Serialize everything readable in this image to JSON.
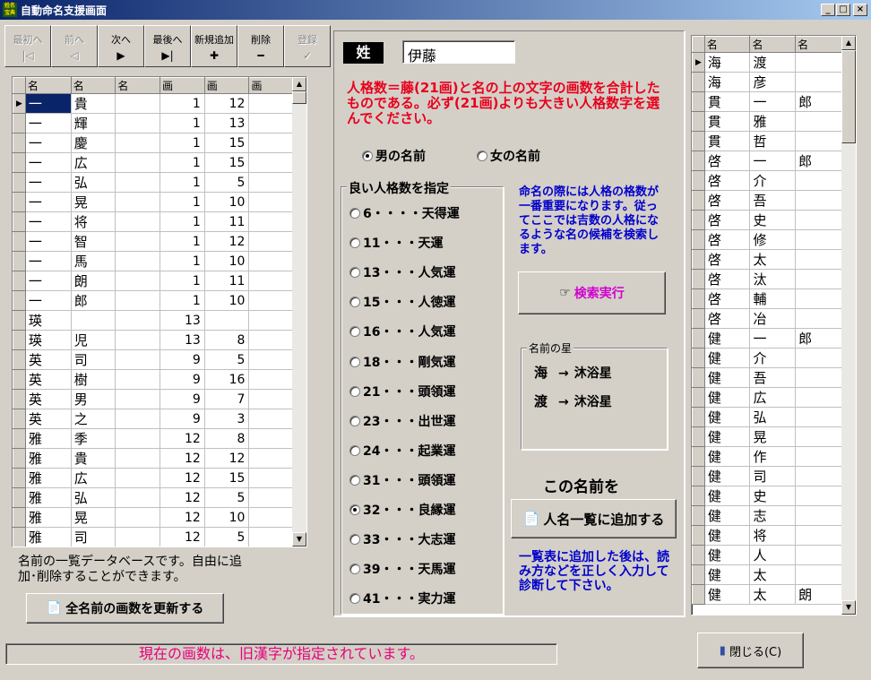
{
  "window": {
    "title": "自動命名支援画面",
    "icon_text": "姓名宝典",
    "buttons": [
      "_",
      "□",
      "×"
    ]
  },
  "navigator": [
    {
      "label": "最初へ",
      "glyph": "|◁",
      "enabled": false
    },
    {
      "label": "前へ",
      "glyph": "◁",
      "enabled": false
    },
    {
      "label": "次へ",
      "glyph": "▶",
      "enabled": true
    },
    {
      "label": "最後へ",
      "glyph": "▶|",
      "enabled": true
    },
    {
      "label": "新規追加",
      "glyph": "✚",
      "enabled": true
    },
    {
      "label": "削除",
      "glyph": "━",
      "enabled": true
    },
    {
      "label": "登録",
      "glyph": "✓",
      "enabled": false
    }
  ],
  "name_db": {
    "columns": [
      "名",
      "名",
      "名",
      "画",
      "画",
      "画"
    ],
    "rows": [
      [
        "一",
        "貴",
        "",
        "1",
        "12",
        ""
      ],
      [
        "一",
        "輝",
        "",
        "1",
        "13",
        ""
      ],
      [
        "一",
        "慶",
        "",
        "1",
        "15",
        ""
      ],
      [
        "一",
        "広",
        "",
        "1",
        "15",
        ""
      ],
      [
        "一",
        "弘",
        "",
        "1",
        "5",
        ""
      ],
      [
        "一",
        "晃",
        "",
        "1",
        "10",
        ""
      ],
      [
        "一",
        "将",
        "",
        "1",
        "11",
        ""
      ],
      [
        "一",
        "智",
        "",
        "1",
        "12",
        ""
      ],
      [
        "一",
        "馬",
        "",
        "1",
        "10",
        ""
      ],
      [
        "一",
        "朗",
        "",
        "1",
        "11",
        ""
      ],
      [
        "一",
        "郎",
        "",
        "1",
        "10",
        ""
      ],
      [
        "瑛",
        "",
        "",
        "13",
        "",
        ""
      ],
      [
        "瑛",
        "児",
        "",
        "13",
        "8",
        ""
      ],
      [
        "英",
        "司",
        "",
        "9",
        "5",
        ""
      ],
      [
        "英",
        "樹",
        "",
        "9",
        "16",
        ""
      ],
      [
        "英",
        "男",
        "",
        "9",
        "7",
        ""
      ],
      [
        "英",
        "之",
        "",
        "9",
        "3",
        ""
      ],
      [
        "雅",
        "季",
        "",
        "12",
        "8",
        ""
      ],
      [
        "雅",
        "貴",
        "",
        "12",
        "12",
        ""
      ],
      [
        "雅",
        "広",
        "",
        "12",
        "15",
        ""
      ],
      [
        "雅",
        "弘",
        "",
        "12",
        "5",
        ""
      ],
      [
        "雅",
        "晃",
        "",
        "12",
        "10",
        ""
      ],
      [
        "雅",
        "司",
        "",
        "12",
        "5",
        ""
      ]
    ],
    "description": "名前の一覧データベースです。自由に追加･削除することができます。",
    "update_button": "全名前の画数を更新する"
  },
  "surname": {
    "label": "姓",
    "value": "伊藤"
  },
  "instruction": "人格数＝藤(21画)と名の上の文字の画数を合計したものである。必ず(21画)よりも大きい人格数字を選んでください。",
  "gender": {
    "male": "男の名前",
    "female": "女の名前",
    "selected": "male"
  },
  "fortune": {
    "group_label": "良い人格数を指定",
    "options": [
      "6・・・・天得運",
      "11・・・天運",
      "13・・・人気運",
      "15・・・人徳運",
      "16・・・人気運",
      "18・・・剛気運",
      "21・・・頭領運",
      "23・・・出世運",
      "24・・・起業運",
      "31・・・頭領運",
      "32・・・良縁運",
      "33・・・大志運",
      "39・・・天馬運",
      "41・・・実力運"
    ],
    "selected_index": 10
  },
  "search_hint": "命名の際には人格の格数が一番重要になります。従ってここでは吉数の人格になるような名の候補を検索します。",
  "search_button": "検索実行",
  "stars": {
    "label": "名前の星",
    "entries": [
      {
        "char": "海",
        "arrow": "→",
        "star": "沐浴星"
      },
      {
        "char": "渡",
        "arrow": "→",
        "star": "沐浴星"
      }
    ]
  },
  "add_section": {
    "heading": "この名前を",
    "button": "人名一覧に追加する",
    "hint": "一覧表に追加した後は、読み方などを正しく入力して診断して下さい。"
  },
  "results": {
    "columns": [
      "名",
      "名",
      "名"
    ],
    "rows": [
      [
        "海",
        "渡",
        ""
      ],
      [
        "海",
        "彦",
        ""
      ],
      [
        "貫",
        "一",
        "郎"
      ],
      [
        "貫",
        "雅",
        ""
      ],
      [
        "貫",
        "哲",
        ""
      ],
      [
        "啓",
        "一",
        "郎"
      ],
      [
        "啓",
        "介",
        ""
      ],
      [
        "啓",
        "吾",
        ""
      ],
      [
        "啓",
        "史",
        ""
      ],
      [
        "啓",
        "修",
        ""
      ],
      [
        "啓",
        "太",
        ""
      ],
      [
        "啓",
        "汰",
        ""
      ],
      [
        "啓",
        "輔",
        ""
      ],
      [
        "啓",
        "冶",
        ""
      ],
      [
        "健",
        "一",
        "郎"
      ],
      [
        "健",
        "介",
        ""
      ],
      [
        "健",
        "吾",
        ""
      ],
      [
        "健",
        "広",
        ""
      ],
      [
        "健",
        "弘",
        ""
      ],
      [
        "健",
        "晃",
        ""
      ],
      [
        "健",
        "作",
        ""
      ],
      [
        "健",
        "司",
        ""
      ],
      [
        "健",
        "史",
        ""
      ],
      [
        "健",
        "志",
        ""
      ],
      [
        "健",
        "将",
        ""
      ],
      [
        "健",
        "人",
        ""
      ],
      [
        "健",
        "太",
        ""
      ],
      [
        "健",
        "太",
        "朗"
      ]
    ]
  },
  "status": "現在の画数は、旧漢字が指定されています。",
  "close_button": "閉じる(C)",
  "colors": {
    "instruction": "#e8001c",
    "hint": "#0000cc",
    "search_label": "#d000d0",
    "status": "#e8007a",
    "title_start": "#0a246a",
    "title_end": "#a6caf0"
  }
}
